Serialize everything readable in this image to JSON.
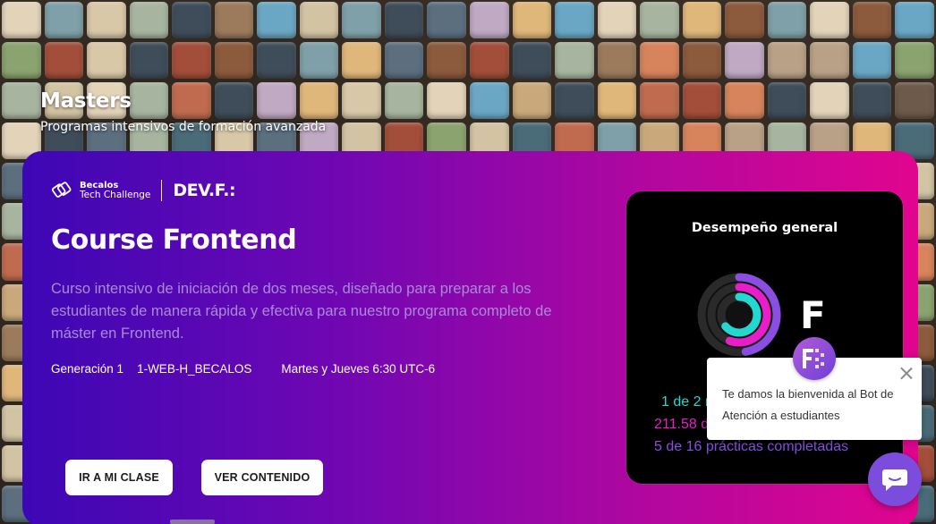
{
  "hero": {
    "title": "Masters",
    "subtitle": "Programas intensivos de formación avanzada"
  },
  "logos": {
    "becalos_line1": "Becalos",
    "becalos_line2": "Tech Challenge",
    "devf": "DEV.F.:"
  },
  "course": {
    "title": "Course Frontend",
    "description": "Curso intensivo de iniciación de dos meses, diseñado para preparar a los estudiantes de manera rápida y efectiva para nuestro programa completo de máster en Frontend.",
    "generation": "Generación 1",
    "code": "1-WEB-H_BECALOS",
    "schedule": "Martes y Jueves 6:30 UTC-6"
  },
  "buttons": {
    "class": "IR A MI CLASE",
    "content": "VER CONTENIDO"
  },
  "performance": {
    "title": "Desempeño general",
    "grade": "F",
    "stat_1": "1 de 2 r",
    "stat_2": "211.58 de",
    "stat_3": "5 de 16 prácticas completadas",
    "colors": {
      "ring_outer": "#8a4ee0",
      "ring_middle": "#e81ec8",
      "ring_inner": "#22d8d0"
    }
  },
  "chatbot": {
    "message": "Te damos la bienvenida al Bot de Atención a estudiantes",
    "close_icon": "close-icon",
    "avatar_icon": "devf-logo-icon",
    "fab_icon": "chat-bubble-icon"
  }
}
